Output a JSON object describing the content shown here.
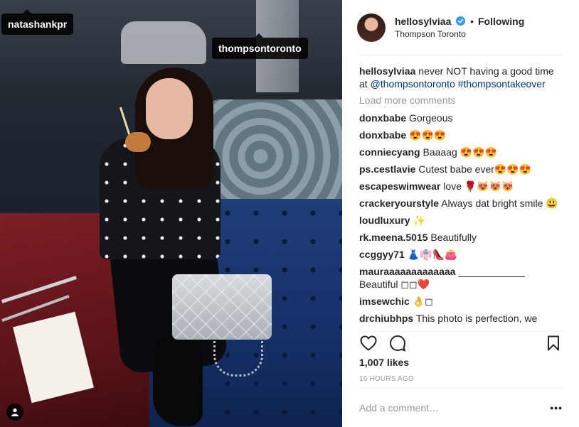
{
  "photo": {
    "tags": [
      "natashankpr",
      "thompsontoronto"
    ]
  },
  "header": {
    "username": "hellosylviaa",
    "separator": "•",
    "follow_state": "Following",
    "location": "Thompson Toronto"
  },
  "caption": {
    "username": "hellosylviaa",
    "text_1": " never NOT having a good time at ",
    "mention": "@thompsontoronto",
    "hashtag": "#thompsontakeover"
  },
  "load_more": "Load more comments",
  "comments": [
    {
      "user": "donxbabe",
      "text": "Gorgeous"
    },
    {
      "user": "donxbabe",
      "text": "😍😍😍"
    },
    {
      "user": "conniecyang",
      "text": "Baaaag 😍😍😍"
    },
    {
      "user": "ps.cestlavie",
      "text": "Cutest babe ever😍😍😍"
    },
    {
      "user": "escapeswimwear",
      "text": "love 🌹😻😻😻"
    },
    {
      "user": "crackeryourstyle",
      "text": "Always dat bright smile 😃"
    },
    {
      "user": "loudluxury",
      "text": "✨"
    },
    {
      "user": "rk.meena.5015",
      "text": "Beautifully"
    },
    {
      "user": "ccggyy71",
      "text": "👗👘👠👛"
    },
    {
      "user": "mauraaaaaaaaaaaaa",
      "text": "____________ Beautiful ◻◻❤️"
    },
    {
      "user": "imsewchic",
      "text": "👌◻"
    },
    {
      "user": "drchiubhps",
      "text": "This photo is perfection, we"
    }
  ],
  "likes": "1,007 likes",
  "time_ago": "16 HOURS AGO",
  "add_comment_placeholder": "Add a comment…",
  "more_options": "•••",
  "colors": {
    "verified": "#3897f0",
    "link": "#003569",
    "muted": "#999999",
    "text": "#262626"
  }
}
